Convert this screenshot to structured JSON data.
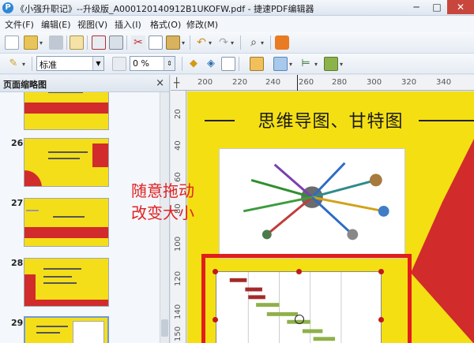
{
  "window": {
    "title": "《小强升职记》--升级版_A000120140912B1UKOFW.pdf - 捷速PDF编辑器",
    "app_icon": "P",
    "minimize": "─",
    "maximize": "□",
    "close": "✕"
  },
  "menu": [
    "文件(F)",
    "编辑(E)",
    "视图(V)",
    "插入(I)",
    "格式(O)",
    "修改(M)"
  ],
  "toolbar2": {
    "style_value": "标准",
    "percent_value": "0 %"
  },
  "panel": {
    "title": "页面缩略图",
    "close": "×",
    "pages": [
      "26",
      "27",
      "28",
      "29"
    ]
  },
  "ruler": {
    "top": [
      "200",
      "220",
      "240",
      "260",
      "280",
      "300",
      "320",
      "340"
    ],
    "left": [
      "20",
      "40",
      "60",
      "80",
      "100",
      "120",
      "140",
      "150"
    ]
  },
  "document": {
    "slide_title": "思维导图、甘特图",
    "overlay_line1": "随意拖动",
    "overlay_line2": "改变大小"
  },
  "colors": {
    "slide_yellow": "#f4df13",
    "slide_red": "#d12b2b",
    "frame_red": "#e11d1d"
  }
}
